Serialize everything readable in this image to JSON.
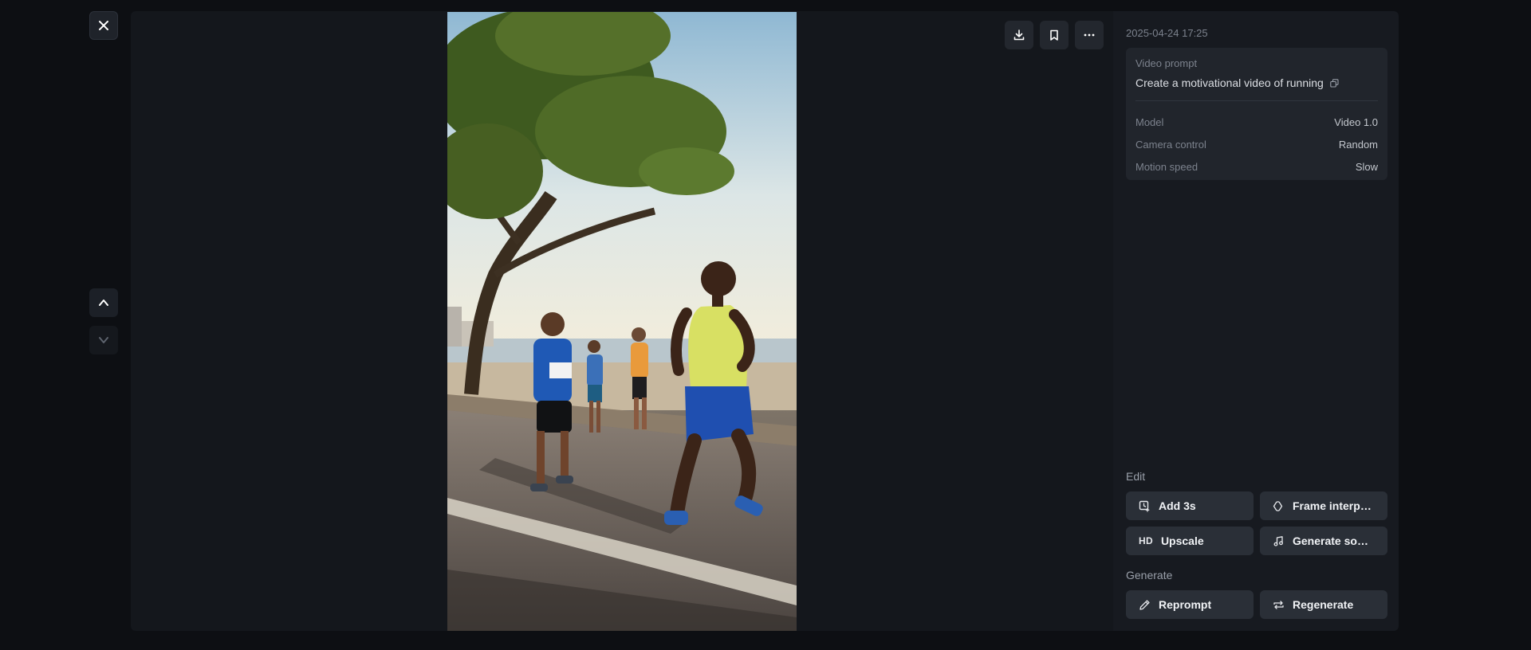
{
  "left_controls": {
    "close": "close-icon",
    "up": "chevron-up-icon",
    "down": "chevron-down-icon"
  },
  "viewer": {
    "actions": [
      "download-icon",
      "bookmark-icon",
      "more-icon"
    ],
    "video_subject": "runners-on-seaside-promenade"
  },
  "panel": {
    "timestamp": "2025-04-24 17:25",
    "prompt_label": "Video prompt",
    "prompt_text": "Create a motivational video of running",
    "details": [
      {
        "key": "Model",
        "value": "Video 1.0"
      },
      {
        "key": "Camera control",
        "value": "Random"
      },
      {
        "key": "Motion speed",
        "value": "Slow"
      }
    ],
    "edit_title": "Edit",
    "edit_buttons": {
      "add": "Add 3s",
      "interp": "Frame interpol...",
      "upscale": "Upscale",
      "upscale_glyph": "HD",
      "sound": "Generate soun..."
    },
    "generate_title": "Generate",
    "generate_buttons": {
      "reprompt": "Reprompt",
      "regenerate": "Regenerate"
    }
  },
  "colors": {
    "background": "#0d0f13",
    "panel": "#171a20",
    "button": "#2a2f37"
  }
}
